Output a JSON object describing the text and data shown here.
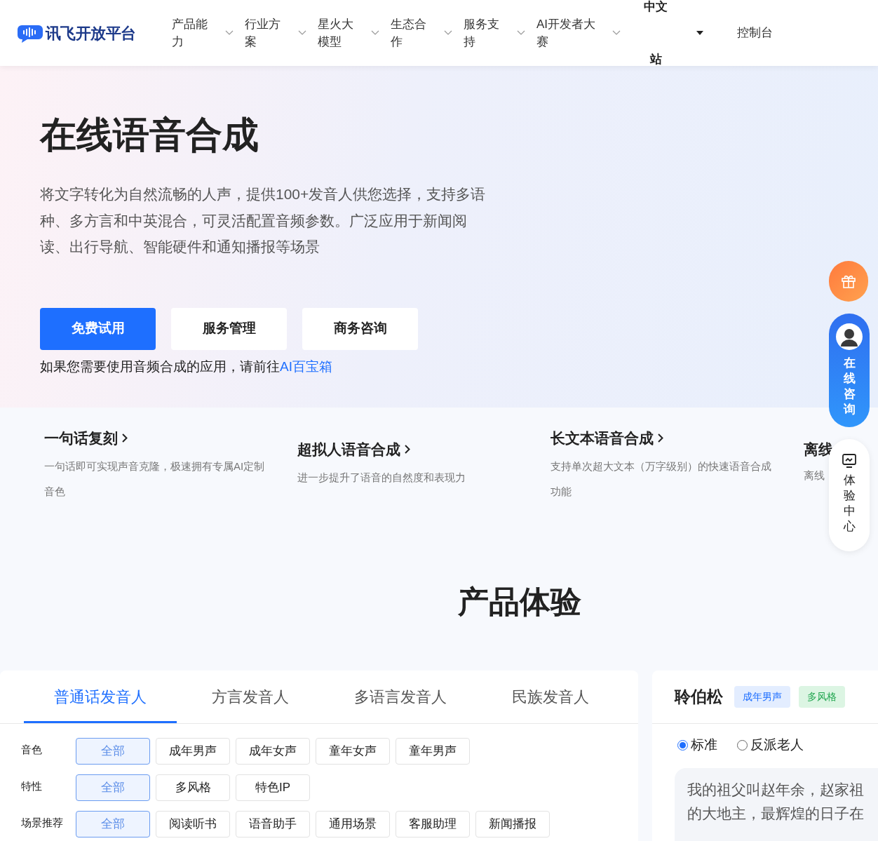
{
  "nav": {
    "logo": "讯飞开放平台",
    "items": [
      {
        "label": "产品能力"
      },
      {
        "label": "行业方案"
      },
      {
        "label": "星火大模型"
      },
      {
        "label": "生态合作"
      },
      {
        "label": "服务支持"
      },
      {
        "label": "AI开发者大赛"
      }
    ],
    "language": "中文站",
    "console": "控制台"
  },
  "hero": {
    "title": "在线语音合成",
    "description": "将文字转化为自然流畅的人声，提供100+发音人供您选择，支持多语种、多方言和中英混合，可灵活配置音频参数。广泛应用于新闻阅读、出行导航、智能硬件和通知播报等场景",
    "buttons": [
      {
        "label": "免费试用",
        "kind": "primary"
      },
      {
        "label": "服务管理",
        "kind": "plain"
      },
      {
        "label": "商务咨询",
        "kind": "plain"
      }
    ],
    "note": "如果您需要使用音频合成的应用，请前往",
    "note_link": "AI百宝箱"
  },
  "features": [
    {
      "title": "一句话复刻",
      "description": "一句话即可实现声音克隆，极速拥有专属AI定制音色"
    },
    {
      "title": "超拟人语音合成",
      "description": "进一步提升了语音的自然度和表现力"
    },
    {
      "title": "长文本语音合成",
      "description": "支持单次超大文本（万字级别）的快速语音合成功能"
    },
    {
      "title_parts": [
        "离线"
      ],
      "description_parts": [
        "离线"
      ]
    }
  ],
  "floating": {
    "consult": "在线咨询",
    "experience": "体验中心"
  },
  "section_title": "产品体验",
  "tabs": [
    {
      "label": "普通话发音人",
      "selected": true
    },
    {
      "label": "方言发音人",
      "selected": false
    },
    {
      "label": "多语言发音人",
      "selected": false
    },
    {
      "label": "民族发音人",
      "selected": false
    }
  ],
  "filters": [
    {
      "label": "音色",
      "options": [
        {
          "label": "全部",
          "selected": true
        },
        {
          "label": "成年男声",
          "selected": false
        },
        {
          "label": "成年女声",
          "selected": false
        },
        {
          "label": "童年女声",
          "selected": false
        },
        {
          "label": "童年男声",
          "selected": false
        }
      ]
    },
    {
      "label": "特性",
      "options": [
        {
          "label": "全部",
          "selected": true
        },
        {
          "label": "多风格",
          "selected": false
        },
        {
          "label": "特色IP",
          "selected": false
        }
      ]
    },
    {
      "label": "场景推荐",
      "options": [
        {
          "label": "全部",
          "selected": true
        },
        {
          "label": "阅读听书",
          "selected": false
        },
        {
          "label": "语音助手",
          "selected": false
        },
        {
          "label": "通用场景",
          "selected": false
        },
        {
          "label": "客服助理",
          "selected": false
        },
        {
          "label": "新闻播报",
          "selected": false
        }
      ]
    }
  ],
  "voice": {
    "name": "聆伯松",
    "tags": [
      {
        "label": "成年男声",
        "color": "#1e6fff"
      },
      {
        "label": "多风格",
        "color": "#22a650"
      }
    ],
    "styles": [
      {
        "label": "标准",
        "selected": true
      },
      {
        "label": "反派老人",
        "selected": false
      }
    ],
    "sample_lines": [
      "我的祖父叫赵年余，赵家祖",
      "的大地主，最辉煌的日子在"
    ]
  }
}
